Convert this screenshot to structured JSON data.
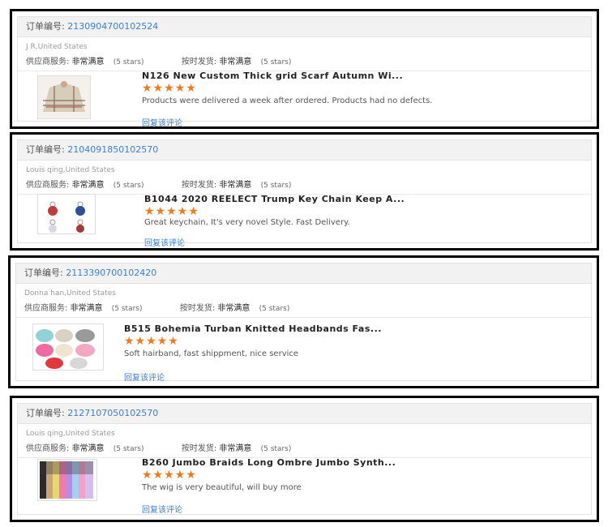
{
  "labels": {
    "order_no": "订单编号:",
    "supplier_service": "供应商服务:",
    "on_time": "按时发货:",
    "reply": "回复该评论"
  },
  "star_color": "#f07a1a",
  "link_color": "#3a7fd1",
  "reviews": [
    {
      "order_id": "2130904700102524",
      "buyer": "J R,United States",
      "supplier_rating": "非常满意",
      "supplier_stars": "(5 stars)",
      "shipping_rating": "非常满意",
      "shipping_stars": "(5 stars)",
      "title": "N126 New Custom Thick grid Scarf Autumn Wi...",
      "stars": "★★★★★",
      "rating": 5,
      "comment": "Products were delivered a week after ordered. Products had no defects."
    },
    {
      "order_id": "2104091850102570",
      "buyer": "Louis qing,United States",
      "supplier_rating": "非常满意",
      "supplier_stars": "(5 stars)",
      "shipping_rating": "非常满意",
      "shipping_stars": "(5 stars)",
      "title": "B1044 2020 REELECT Trump Key Chain Keep A...",
      "stars": "★★★★★",
      "rating": 5,
      "comment": "Great keychain, It's very novel Style. Fast Delivery."
    },
    {
      "order_id": "2113390700102420",
      "buyer": "Donna han,United States",
      "supplier_rating": "非常满意",
      "supplier_stars": "(5 stars)",
      "shipping_rating": "非常满意",
      "shipping_stars": "(5 stars)",
      "title": "B515 Bohemia Turban Knitted Headbands Fas...",
      "stars": "★★★★★",
      "rating": 5,
      "comment": "Soft hairband, fast shippment, nice service"
    },
    {
      "order_id": "2127107050102570",
      "buyer": "Louis qing,United States",
      "supplier_rating": "非常满意",
      "supplier_stars": "(5 stars)",
      "shipping_rating": "非常满意",
      "shipping_stars": "(5 stars)",
      "title": "B260 Jumbo Braids Long Ombre Jumbo Synth...",
      "stars": "★★★★★",
      "rating": 5,
      "comment": "The wig is very beautiful, will buy more"
    }
  ]
}
